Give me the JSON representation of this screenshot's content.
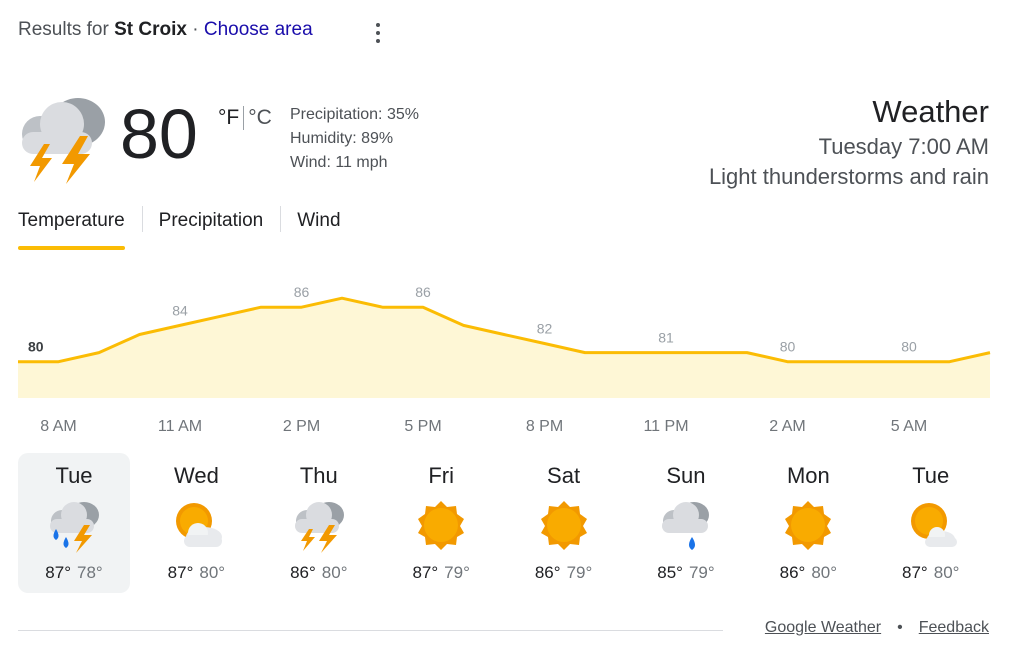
{
  "header": {
    "results_prefix": "Results for",
    "location": "St Croix",
    "separator": "·",
    "choose_area": "Choose area",
    "more_icon": "more-vert-icon"
  },
  "current": {
    "icon": "thunderstorm-icon",
    "temperature": "80",
    "unit_f": "°F",
    "unit_c": "°C",
    "precipitation": "Precipitation: 35%",
    "humidity": "Humidity: 89%",
    "wind": "Wind: 11 mph"
  },
  "summary": {
    "title": "Weather",
    "time": "Tuesday 7:00 AM",
    "condition": "Light thunderstorms and rain"
  },
  "tabs": [
    {
      "label": "Temperature",
      "active": true
    },
    {
      "label": "Precipitation",
      "active": false
    },
    {
      "label": "Wind",
      "active": false
    }
  ],
  "colors": {
    "accent": "#fbbc04",
    "area_fill": "#fef7d6",
    "sun": "#f29900",
    "cloud": "#dadce0",
    "rain": "#1a73e8"
  },
  "chart_data": {
    "type": "area",
    "hours": [
      "7 AM",
      "8 AM",
      "9 AM",
      "10 AM",
      "11 AM",
      "12 PM",
      "1 PM",
      "2 PM",
      "3 PM",
      "4 PM",
      "5 PM",
      "6 PM",
      "7 PM",
      "8 PM",
      "9 PM",
      "10 PM",
      "11 PM",
      "12 AM",
      "1 AM",
      "2 AM",
      "3 AM",
      "4 AM",
      "5 AM",
      "6 AM",
      "7 AM"
    ],
    "values": [
      80,
      80,
      81,
      83,
      84,
      85,
      86,
      86,
      87,
      86,
      86,
      84,
      83,
      82,
      81,
      81,
      81,
      81,
      81,
      80,
      80,
      80,
      80,
      80,
      81
    ],
    "labels": [
      {
        "index": 0,
        "value": "80",
        "bold": true
      },
      {
        "index": 4,
        "value": "84"
      },
      {
        "index": 7,
        "value": "86"
      },
      {
        "index": 10,
        "value": "86"
      },
      {
        "index": 13,
        "value": "82"
      },
      {
        "index": 16,
        "value": "81"
      },
      {
        "index": 19,
        "value": "80"
      },
      {
        "index": 22,
        "value": "80"
      }
    ],
    "x_ticks": [
      {
        "index": 1,
        "label": "8 AM"
      },
      {
        "index": 4,
        "label": "11 AM"
      },
      {
        "index": 7,
        "label": "2 PM"
      },
      {
        "index": 10,
        "label": "5 PM"
      },
      {
        "index": 13,
        "label": "8 PM"
      },
      {
        "index": 16,
        "label": "11 PM"
      },
      {
        "index": 19,
        "label": "2 AM"
      },
      {
        "index": 22,
        "label": "5 AM"
      }
    ],
    "ylim": [
      76,
      89
    ]
  },
  "days": [
    {
      "name": "Tue",
      "icon": "thunderstorm-rain-icon",
      "high": "87°",
      "low": "78°",
      "selected": true
    },
    {
      "name": "Wed",
      "icon": "partly-cloudy-icon",
      "high": "87°",
      "low": "80°",
      "selected": false
    },
    {
      "name": "Thu",
      "icon": "thunderstorm-icon",
      "high": "86°",
      "low": "80°",
      "selected": false
    },
    {
      "name": "Fri",
      "icon": "sunny-icon",
      "high": "87°",
      "low": "79°",
      "selected": false
    },
    {
      "name": "Sat",
      "icon": "sunny-icon",
      "high": "86°",
      "low": "79°",
      "selected": false
    },
    {
      "name": "Sun",
      "icon": "rain-cloud-icon",
      "high": "85°",
      "low": "79°",
      "selected": false
    },
    {
      "name": "Mon",
      "icon": "sunny-icon",
      "high": "86°",
      "low": "80°",
      "selected": false
    },
    {
      "name": "Tue",
      "icon": "partly-cloudy-icon",
      "high": "87°",
      "low": "80°",
      "selected": false
    }
  ],
  "footer": {
    "source_link": "Google Weather",
    "dot": "•",
    "feedback_link": "Feedback"
  }
}
